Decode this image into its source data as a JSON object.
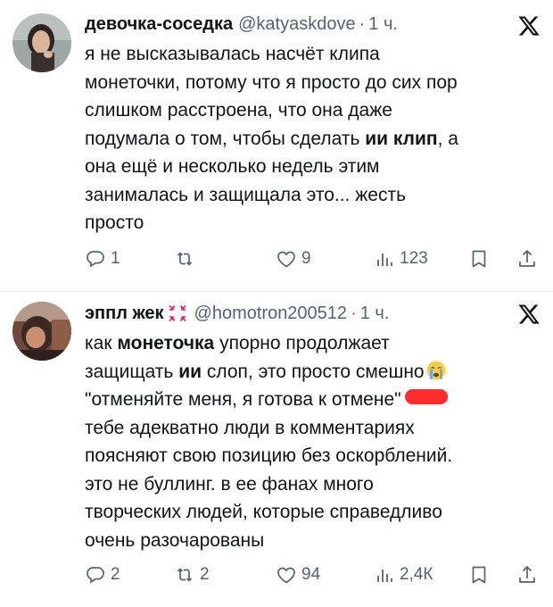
{
  "tweets": [
    {
      "display_name": "девочка-соседка",
      "handle": "@katyaskdove",
      "separator": "·",
      "time": "1 ч.",
      "text_lines": [
        [
          "я не высказывалась насчёт клипа"
        ],
        [
          "монеточки, потому что я просто до сих пор"
        ],
        [
          "слишком расстроена, что она даже"
        ],
        [
          "подумала о том, чтобы сделать ",
          "ии клип",
          ", а"
        ],
        [
          "она ещё и несколько недель этим"
        ],
        [
          "занималась и защищала это... жесть"
        ],
        [
          "просто"
        ]
      ],
      "stats": {
        "replies": "1",
        "retweets": "",
        "likes": "9",
        "views": "123"
      }
    },
    {
      "display_name": "эппл жек",
      "name_emoji": "angry-symbol-icon",
      "handle": "@homotron200512",
      "separator": "·",
      "time": "1 ч.",
      "text_lines": [
        [
          "как ",
          "монеточка",
          " упорно продолжает"
        ],
        [
          "защищать ",
          "ии",
          " слоп, это просто смешно"
        ],
        [
          "\"отменяйте меня, я готова к отмене\""
        ],
        [
          "тебе адекватно люди в комментариях"
        ],
        [
          "поясняют свою позицию без оскорблений."
        ],
        [
          "это не буллинг. в ее фанах много"
        ],
        [
          "творческих людей, которые справедливо"
        ],
        [
          "очень разочарованы"
        ]
      ],
      "stats": {
        "replies": "2",
        "retweets": "2",
        "likes": "94",
        "views": "2,4К"
      }
    }
  ],
  "colors": {
    "text": "#0f1419",
    "secondary": "#536471",
    "divider": "#e8ecef",
    "redaction": "#ff2d2d"
  }
}
